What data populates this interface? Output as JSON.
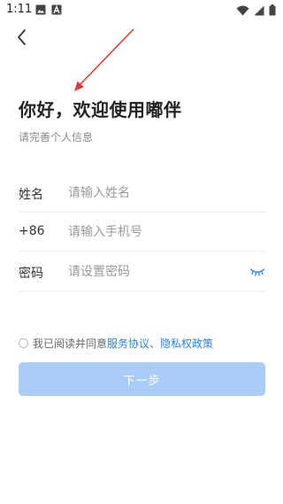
{
  "status_bar": {
    "time": "1:11",
    "left_icons": [
      "image-icon",
      "font-icon"
    ],
    "right_icons": [
      "wifi-icon",
      "cellular-signal-icon",
      "battery-icon"
    ]
  },
  "header": {
    "back_icon": "chevron-left-icon",
    "title": "你好，欢迎使用嘟伴",
    "subtitle": "请完善个人信息"
  },
  "form": {
    "name": {
      "label": "姓名",
      "placeholder": "请输入姓名",
      "value": ""
    },
    "phone": {
      "label": "+86",
      "placeholder": "请输入手机号",
      "value": ""
    },
    "password": {
      "label": "密码",
      "placeholder": "请设置密码",
      "value": "",
      "toggle_icon": "eye-closed-icon"
    }
  },
  "agreement": {
    "checked": false,
    "prefix": "我已阅读并同意",
    "terms_link": "服务协议",
    "separator": "、",
    "privacy_link": "隐私权政策"
  },
  "next_button": {
    "label": "下一步",
    "enabled": false
  },
  "colors": {
    "link": "#2a7fe0",
    "button_disabled": "#a9cdf6",
    "annotation_arrow": "#e03a36"
  }
}
